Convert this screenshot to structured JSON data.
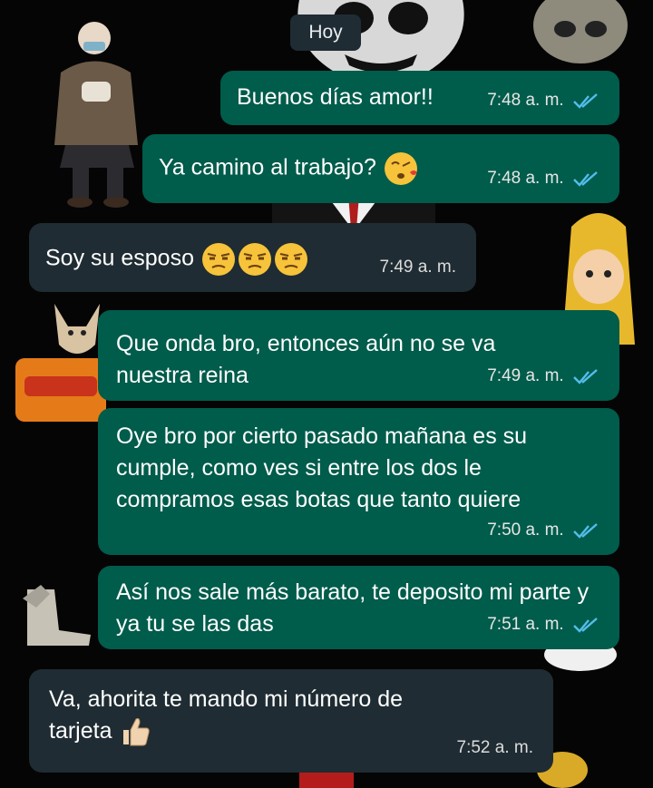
{
  "date_chip": "Hoy",
  "messages": [
    {
      "direction": "out",
      "text": "Buenos días amor!!",
      "time": "7:48 a. m.",
      "status": "read"
    },
    {
      "direction": "out",
      "text": "Ya camino al trabajo?",
      "emoji": "kiss-face-emoji",
      "time": "7:48 a. m.",
      "status": "read"
    },
    {
      "direction": "in",
      "text": "Soy su esposo",
      "emoji": "unamused-face-emoji x3",
      "time": "7:49 a. m."
    },
    {
      "direction": "out",
      "text": "Que onda bro, entonces aún no se va nuestra reina",
      "time": "7:49 a. m.",
      "status": "read"
    },
    {
      "direction": "out",
      "text": "Oye bro por cierto pasado mañana es su cumple, como ves si entre los dos le compramos esas botas que tanto quiere",
      "time": "7:50 a. m.",
      "status": "read"
    },
    {
      "direction": "out",
      "text": "Así nos sale más barato, te deposito mi parte y ya tu se las das",
      "time": "7:51 a. m.",
      "status": "read"
    },
    {
      "direction": "in",
      "text": "Va, ahorita te mando mi número de tarjeta",
      "emoji": "thumbs-up-emoji",
      "time": "7:52 a. m."
    }
  ],
  "colors": {
    "outgoing_bubble": "#005c4b",
    "incoming_bubble": "#1f2c33",
    "read_ticks": "#53bdeb",
    "background": "#050505"
  }
}
